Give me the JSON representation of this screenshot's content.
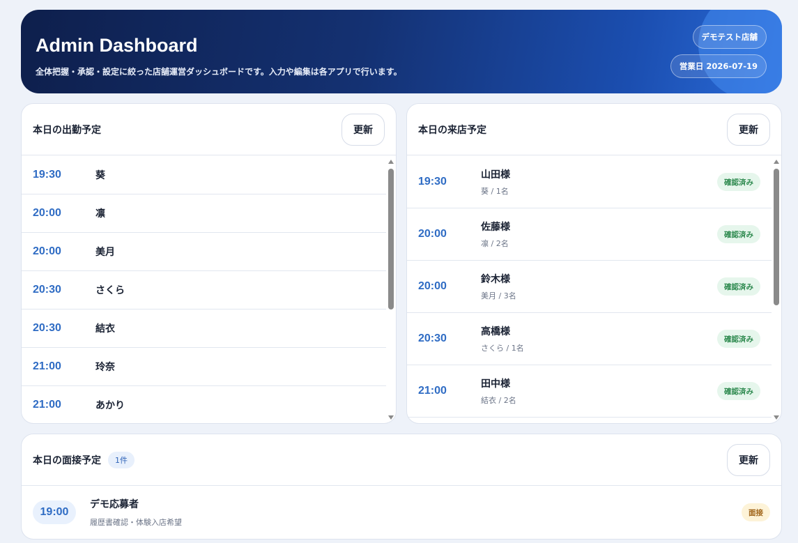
{
  "header": {
    "title": "Admin Dashboard",
    "subtitle": "全体把握・承認・設定に絞った店舗運営ダッシュボードです。入力や編集は各アプリで行います。",
    "store": "デモテスト店舗",
    "business_day": "営業日 2026-07-19"
  },
  "shifts": {
    "title": "本日の出勤予定",
    "refresh_label": "更新",
    "rows": [
      {
        "time": "19:30",
        "name": "葵"
      },
      {
        "time": "20:00",
        "name": "凛"
      },
      {
        "time": "20:00",
        "name": "美月"
      },
      {
        "time": "20:30",
        "name": "さくら"
      },
      {
        "time": "20:30",
        "name": "結衣"
      },
      {
        "time": "21:00",
        "name": "玲奈"
      },
      {
        "time": "21:00",
        "name": "あかり"
      }
    ]
  },
  "visits": {
    "title": "本日の来店予定",
    "refresh_label": "更新",
    "rows": [
      {
        "time": "19:30",
        "name": "山田様",
        "detail": "葵 / 1名",
        "status": "確認済み"
      },
      {
        "time": "20:00",
        "name": "佐藤様",
        "detail": "凛 / 2名",
        "status": "確認済み"
      },
      {
        "time": "20:00",
        "name": "鈴木様",
        "detail": "美月 / 3名",
        "status": "確認済み"
      },
      {
        "time": "20:30",
        "name": "高橋様",
        "detail": "さくら / 1名",
        "status": "確認済み"
      },
      {
        "time": "21:00",
        "name": "田中様",
        "detail": "結衣 / 2名",
        "status": "確認済み"
      }
    ]
  },
  "interviews": {
    "title": "本日の面接予定",
    "count": "1件",
    "refresh_label": "更新",
    "rows": [
      {
        "time": "19:00",
        "name": "デモ応募者",
        "detail": "履歴書確認・体験入店希望",
        "tag": "面接"
      }
    ]
  },
  "colors": {
    "accent": "#2f6cc4",
    "header_start": "#0e1f4c",
    "header_end": "#2a6bd8",
    "status_confirmed": "#2e8a4f",
    "interview_tag": "#a0651a"
  }
}
